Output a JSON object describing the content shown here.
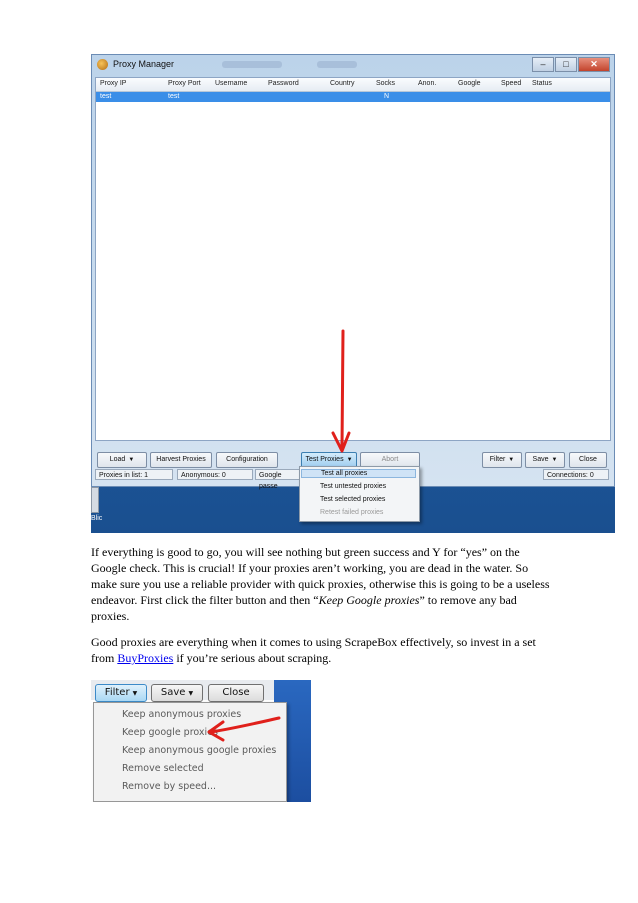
{
  "screenshot1": {
    "window_title": "Proxy Manager",
    "columns": [
      "Proxy IP",
      "Proxy Port",
      "Username",
      "Password",
      "Country",
      "Socks",
      "Anon.",
      "Google",
      "Speed",
      "Status"
    ],
    "row": {
      "proxy_ip": "test",
      "proxy_port": "test",
      "socks": "N"
    },
    "buttons": {
      "load": "Load",
      "harvest": "Harvest Proxies",
      "configuration": "Configuration",
      "test_proxies": "Test Proxies",
      "abort": "Abort",
      "filter": "Filter",
      "save": "Save",
      "close": "Close"
    },
    "status": {
      "proxies_in_list_label": "Proxies in list:",
      "proxies_in_list_value": "1",
      "anonymous_label": "Anonymous:",
      "anonymous_value": "0",
      "google_label": "Google passe",
      "connections_label": "Connections:",
      "connections_value": "0"
    },
    "test_menu": [
      "Test all proxies",
      "Test untested proxies",
      "Test selected proxies",
      "Retest failed proxies"
    ],
    "taskbar_label": "Blic"
  },
  "paragraph1": "If everything is good to go, you will see nothing but green success and Y for “yes” on the Google check. This is crucial! If your proxies aren’t working, you are dead in the water. So make sure you use a reliable provider with quick proxies, otherwise this is going to be a useless endeavor. First click the filter button and then “",
  "paragraph1_em": "Keep Google proxies",
  "paragraph1_end": "” to remove any bad proxies.",
  "paragraph2_before": "Good proxies are everything when it comes to using ScrapeBox effectively, so invest in a set from ",
  "paragraph2_link": "BuyProxies",
  "paragraph2_after": " if you’re serious about scraping.",
  "screenshot2": {
    "buttons": {
      "filter": "Filter",
      "save": "Save",
      "close": "Close"
    },
    "filter_menu": [
      "Keep anonymous proxies",
      "Keep google proxies",
      "Keep anonymous google proxies",
      "Remove selected",
      "Remove by speed..."
    ]
  },
  "colors": {
    "arrow": "#e0201b",
    "selection": "#3a8ee8"
  }
}
